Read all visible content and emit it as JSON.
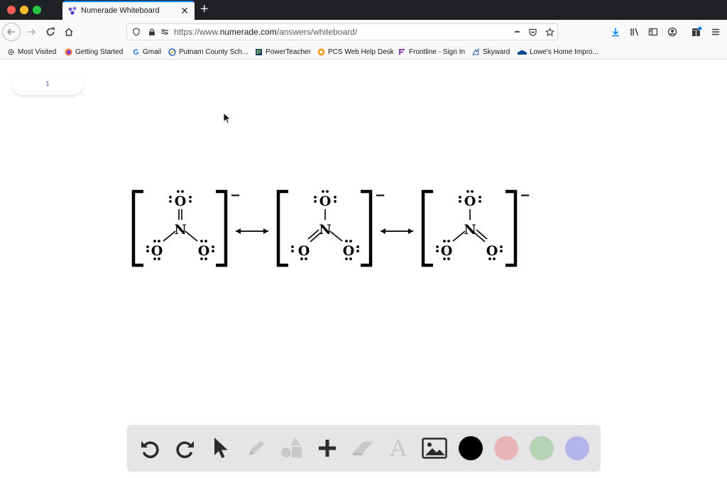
{
  "browser": {
    "tab": {
      "title": "Numerade Whiteboard",
      "close_glyph": "✕"
    },
    "new_tab_glyph": "+",
    "url": {
      "prefix": "https://www.",
      "domain": "numerade.com",
      "path": "/answers/whiteboard/"
    },
    "overflow_glyph": "•••",
    "accent_color": "#0a84ff"
  },
  "bookmarks": [
    {
      "label": "Most Visited",
      "icon": "gear-icon"
    },
    {
      "label": "Getting Started",
      "icon": "firefox-icon"
    },
    {
      "label": "Gmail",
      "icon": "google-icon"
    },
    {
      "label": "Putnam County Sch...",
      "icon": "school-icon"
    },
    {
      "label": "PowerTeacher",
      "icon": "powerteacher-icon"
    },
    {
      "label": "PCS Web Help Desk",
      "icon": "helpdesk-icon"
    },
    {
      "label": "Frontline - Sign In",
      "icon": "frontline-icon"
    },
    {
      "label": "Skyward",
      "icon": "skyward-icon"
    },
    {
      "label": "Lowe's Home Impro...",
      "icon": "lowes-icon"
    }
  ],
  "whiteboard": {
    "page_number": "1",
    "structures": [
      {
        "charge": "−",
        "atoms": {
          "top": "O",
          "center": "N",
          "left": "O",
          "right": "O"
        },
        "double_bond": "top"
      },
      {
        "charge": "−",
        "atoms": {
          "top": "O",
          "center": "N",
          "left": "O",
          "right": "O"
        },
        "double_bond": "left"
      },
      {
        "charge": "−",
        "atoms": {
          "top": "O",
          "center": "N",
          "left": "O",
          "right": "O"
        },
        "double_bond": "right"
      }
    ],
    "resonance_arrow": "double-headed-arrow"
  },
  "toolbar": {
    "tools": [
      {
        "name": "undo",
        "icon": "undo-icon",
        "enabled": true
      },
      {
        "name": "redo",
        "icon": "redo-icon",
        "enabled": true
      },
      {
        "name": "select",
        "icon": "pointer-icon",
        "enabled": true
      },
      {
        "name": "pen",
        "icon": "pencil-icon",
        "enabled": false
      },
      {
        "name": "shapes",
        "icon": "shapes-icon",
        "enabled": false
      },
      {
        "name": "add",
        "icon": "plus-icon",
        "enabled": true
      },
      {
        "name": "eraser",
        "icon": "eraser-icon",
        "enabled": false
      },
      {
        "name": "text",
        "icon": "text-icon",
        "glyph": "A",
        "enabled": false
      },
      {
        "name": "image",
        "icon": "image-icon",
        "enabled": true
      }
    ],
    "colors": [
      "#000000",
      "#e8b4b4",
      "#b4d4b4",
      "#b4b4ec"
    ]
  }
}
